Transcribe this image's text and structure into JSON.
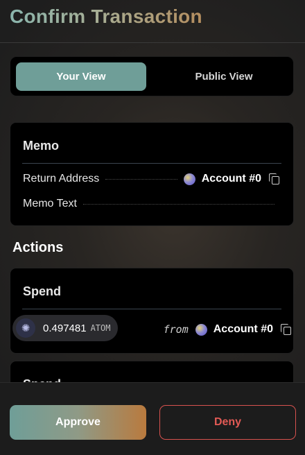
{
  "header": {
    "title": "Confirm Transaction"
  },
  "view_toggle": {
    "tabs": [
      "Your View",
      "Public View"
    ],
    "active": "Your View"
  },
  "memo": {
    "title": "Memo",
    "return_address_label": "Return Address",
    "return_account": "Account #0",
    "memo_text_label": "Memo Text",
    "memo_text_value": ""
  },
  "actions": {
    "title": "Actions",
    "items": [
      {
        "title": "Spend",
        "amount": "0.497481",
        "unit": "ATOM",
        "from_word": "from",
        "from_account": "Account #0",
        "asset_icon": "atom-icon"
      },
      {
        "title": "Spend"
      }
    ]
  },
  "footer": {
    "approve_label": "Approve",
    "deny_label": "Deny"
  },
  "colors": {
    "accent_teal": "#6f9e98",
    "accent_orange": "#b97a3e",
    "deny_red": "#e25a55"
  }
}
